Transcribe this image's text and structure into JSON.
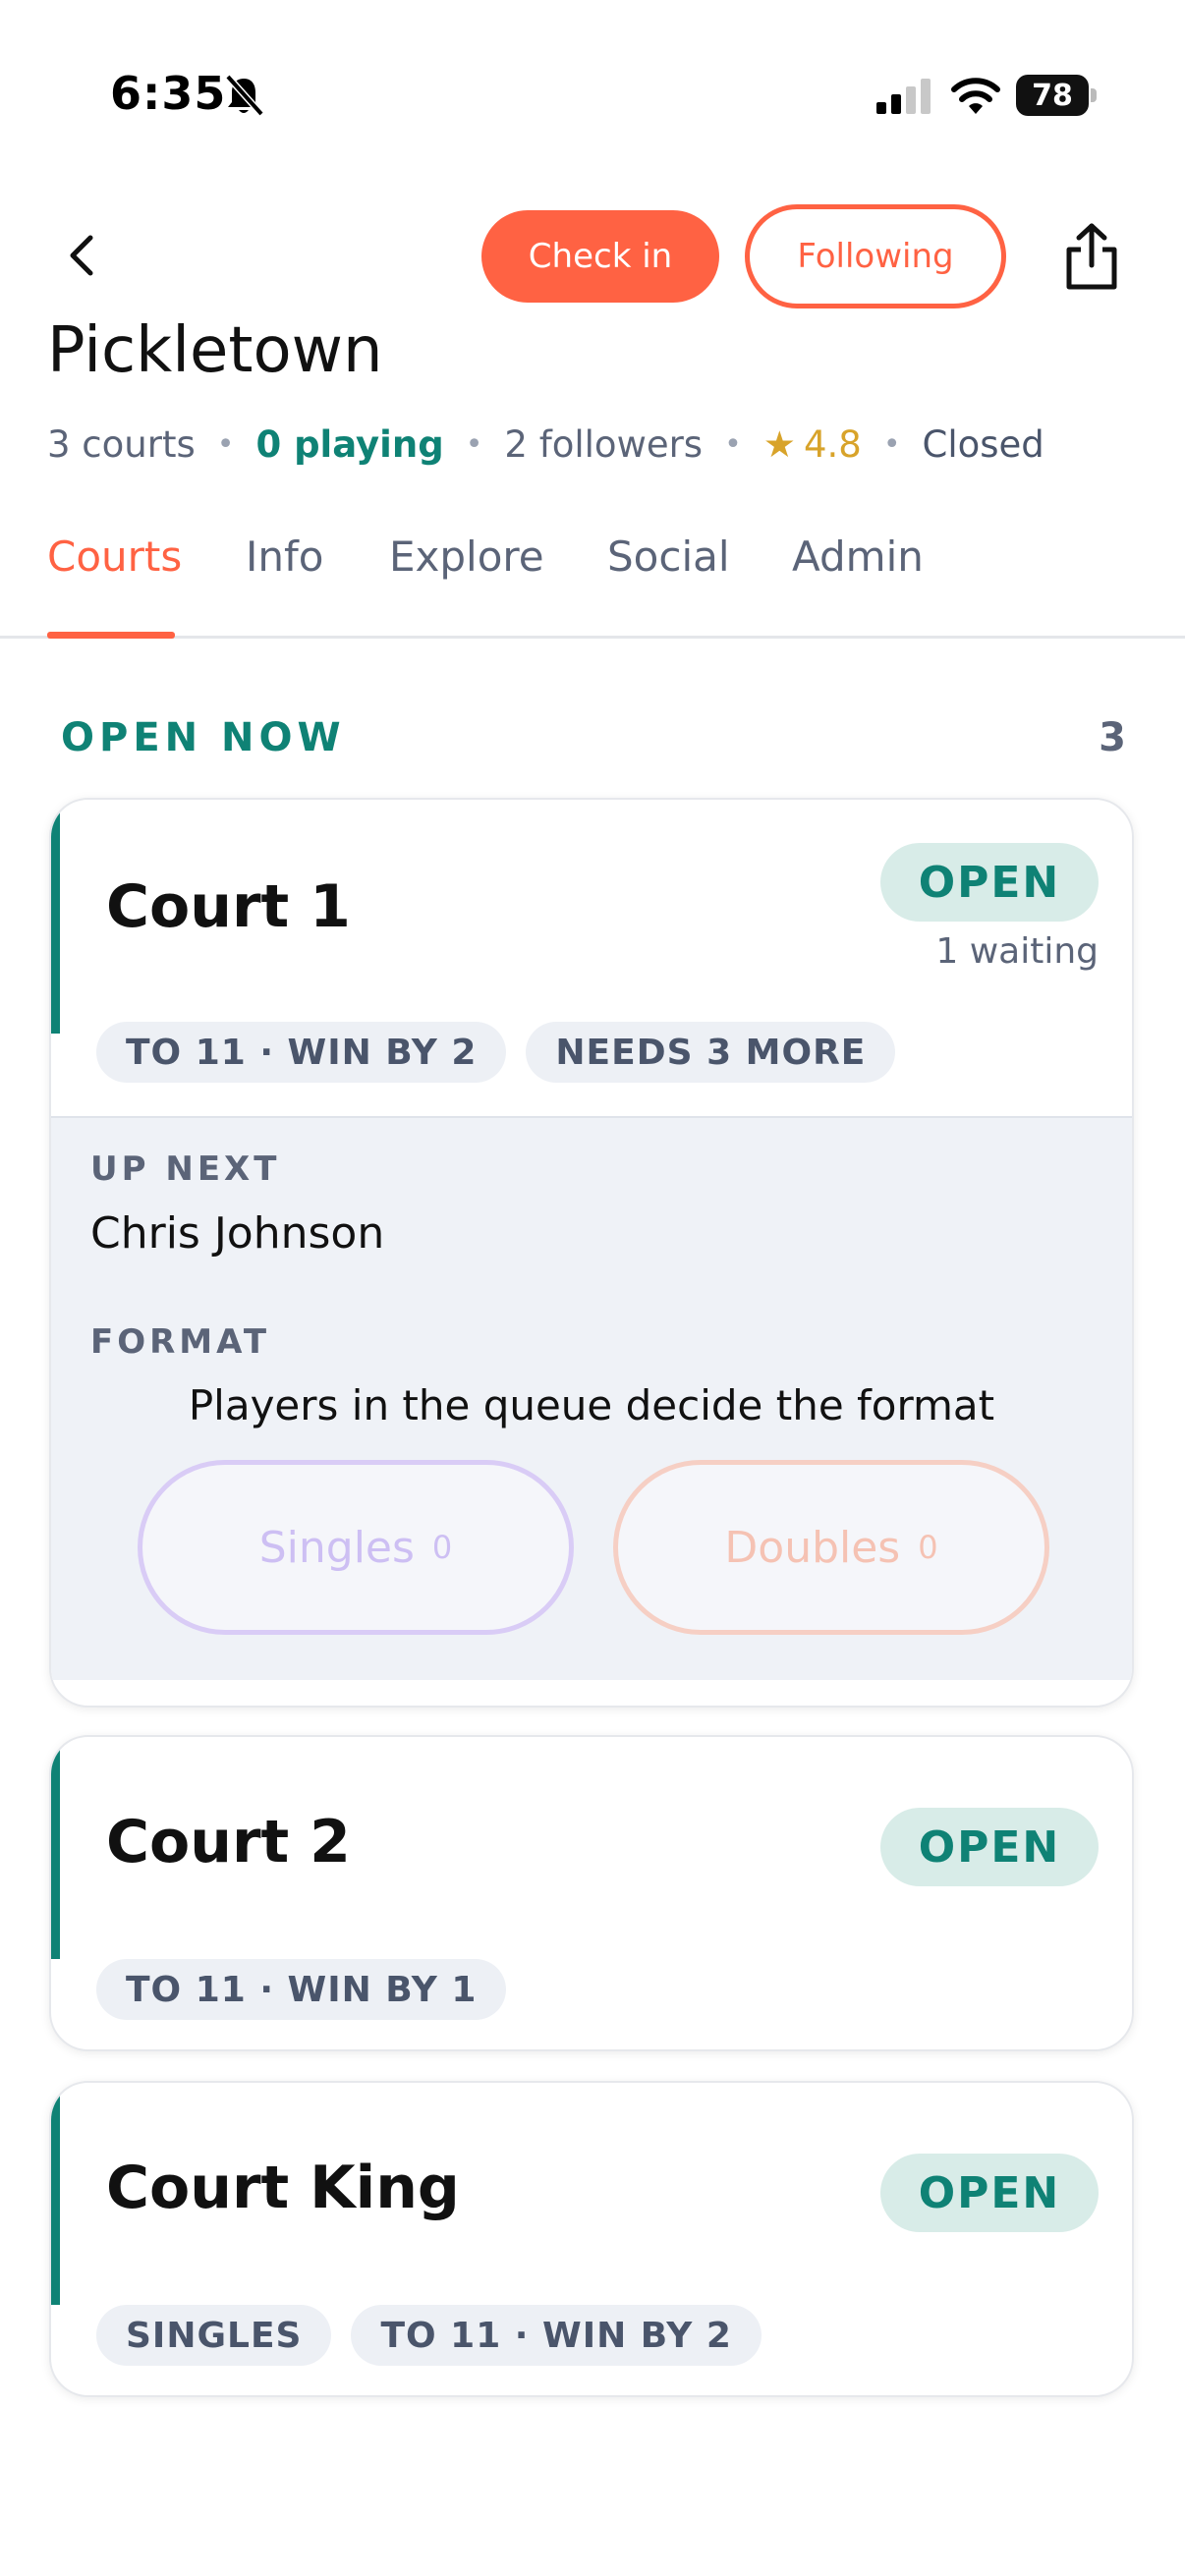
{
  "status_bar": {
    "time": "6:35",
    "battery": "78"
  },
  "header": {
    "checkin_label": "Check in",
    "following_label": "Following",
    "venue_name": "Pickletown",
    "meta": {
      "courts": "3 courts",
      "playing": "0 playing",
      "followers": "2 followers",
      "rating": "4.8",
      "status": "Closed"
    }
  },
  "tabs": [
    {
      "label": "Courts",
      "active": true
    },
    {
      "label": "Info"
    },
    {
      "label": "Explore"
    },
    {
      "label": "Social"
    },
    {
      "label": "Admin"
    }
  ],
  "section": {
    "title": "OPEN NOW",
    "count": "3"
  },
  "courts": [
    {
      "name": "Court 1",
      "status": "OPEN",
      "waiting": "1 waiting",
      "chips": [
        "TO 11 · WIN BY 2",
        "NEEDS 3 MORE"
      ],
      "queue": {
        "up_next_label": "UP NEXT",
        "up_next_name": "Chris Johnson",
        "format_label": "FORMAT",
        "format_note": "Players in the queue decide the format",
        "singles_label": "Singles",
        "singles_count": "0",
        "doubles_label": "Doubles",
        "doubles_count": "0"
      }
    },
    {
      "name": "Court 2",
      "status": "OPEN",
      "chips": [
        "TO 11 · WIN BY 1"
      ]
    },
    {
      "name": "Court King",
      "status": "OPEN",
      "chips": [
        "SINGLES",
        "TO 11 · WIN BY 2"
      ]
    }
  ],
  "colors": {
    "accent": "#ff6243",
    "teal": "#0f8275",
    "muted": "#5b6478"
  },
  "icons": [
    "bell-slash-icon",
    "signal-icon",
    "wifi-icon",
    "battery-icon",
    "back-chevron-icon",
    "share-icon",
    "star-icon"
  ]
}
